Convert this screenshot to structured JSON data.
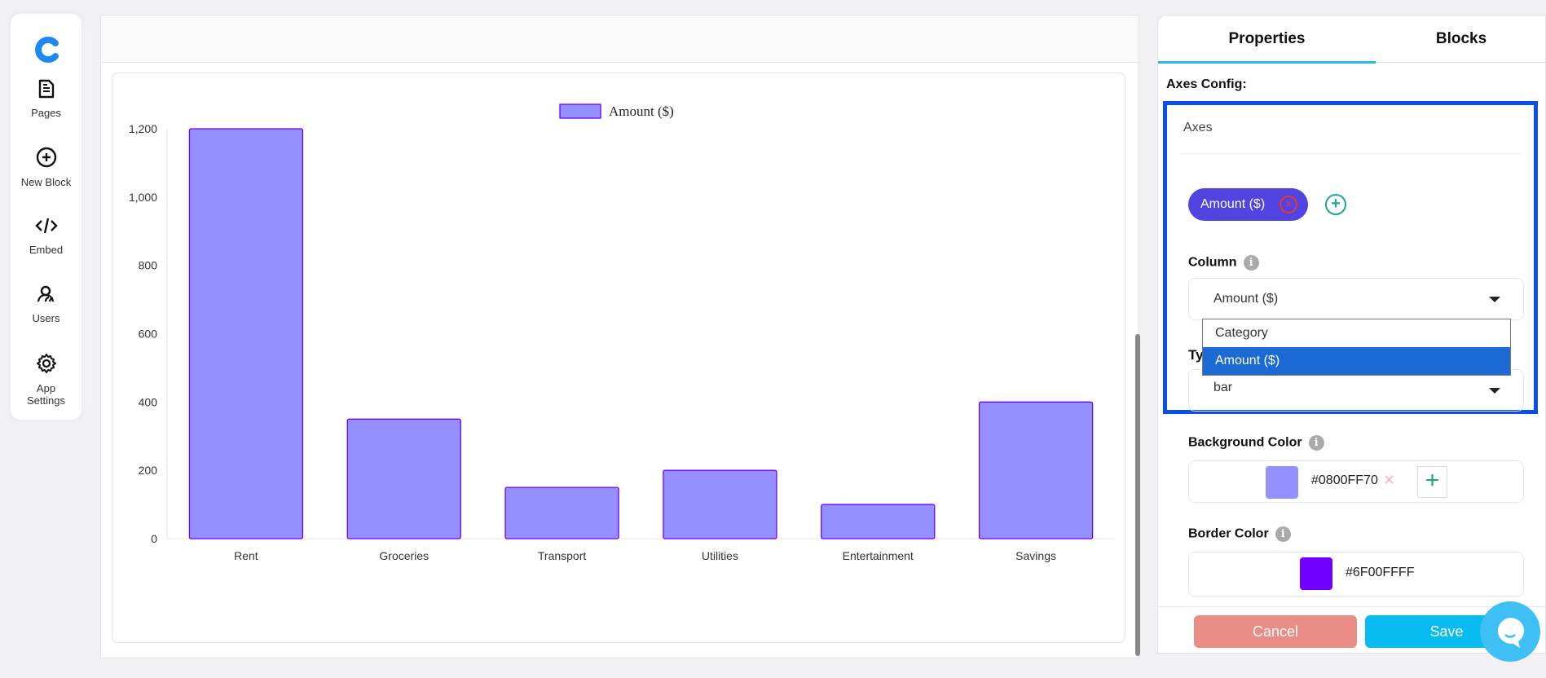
{
  "sidebar": {
    "items": [
      {
        "label": "Pages",
        "icon": "document-icon"
      },
      {
        "label": "New Block",
        "icon": "plus-circle-icon"
      },
      {
        "label": "Embed",
        "icon": "code-icon"
      },
      {
        "label": "Users",
        "icon": "users-icon"
      },
      {
        "label": "App Settings",
        "icon": "gear-icon"
      }
    ]
  },
  "chart_data": {
    "type": "bar",
    "categories": [
      "Rent",
      "Groceries",
      "Transport",
      "Utilities",
      "Entertainment",
      "Savings"
    ],
    "series": [
      {
        "name": "Amount ($)",
        "values": [
          1200,
          350,
          150,
          200,
          100,
          400
        ]
      }
    ],
    "yticks": [
      "0",
      "200",
      "400",
      "600",
      "800",
      "1,000",
      "1,200"
    ],
    "ylim": [
      0,
      1200
    ],
    "legend": "top-center",
    "fill": "#9590ff",
    "border": "#6f00ff",
    "grid": false
  },
  "panel": {
    "tabs": [
      "Properties",
      "Blocks"
    ],
    "axes_config_label": "Axes Config:",
    "axes_title": "Axes",
    "chip": "Amount ($)",
    "column_label": "Column",
    "column_value": "Amount ($)",
    "dropdown_options": [
      "Category",
      "Amount ($)"
    ],
    "type_label": "Ty",
    "type_value": "bar",
    "bg_label": "Background Color",
    "bg_value": "#0800FF70",
    "bg_swatch": "#9590ff",
    "border_label": "Border Color",
    "border_value": "#6F00FFFF",
    "border_swatch": "#6f00ff",
    "cancel": "Cancel",
    "save": "Save"
  }
}
